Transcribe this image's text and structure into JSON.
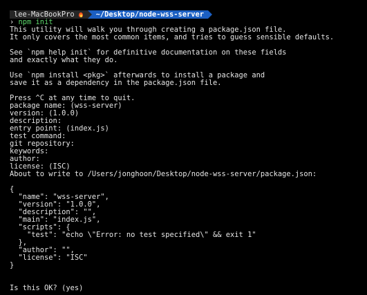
{
  "prompt": {
    "host": "lee-MacBookPro",
    "host_icon": "fire-icon",
    "path": "~/Desktop/node-wss-server"
  },
  "command": {
    "arrow": "›",
    "text": "npm init"
  },
  "output_lines": [
    "This utility will walk you through creating a package.json file.",
    "It only covers the most common items, and tries to guess sensible defaults.",
    "",
    "See `npm help init` for definitive documentation on these fields",
    "and exactly what they do.",
    "",
    "Use `npm install <pkg>` afterwards to install a package and",
    "save it as a dependency in the package.json file.",
    "",
    "Press ^C at any time to quit.",
    "package name: (wss-server)",
    "version: (1.0.0)",
    "description:",
    "entry point: (index.js)",
    "test command:",
    "git repository:",
    "keywords:",
    "author:",
    "license: (ISC)",
    "About to write to /Users/jonghoon/Desktop/node-wss-server/package.json:",
    "",
    "{",
    "  \"name\": \"wss-server\",",
    "  \"version\": \"1.0.0\",",
    "  \"description\": \"\",",
    "  \"main\": \"index.js\",",
    "  \"scripts\": {",
    "    \"test\": \"echo \\\"Error: no test specified\\\" && exit 1\"",
    "  },",
    "  \"author\": \"\",",
    "  \"license\": \"ISC\"",
    "}",
    "",
    "",
    "Is this OK? (yes)"
  ],
  "colors": {
    "background": "#000000",
    "text": "#e6e6e6",
    "host_segment": "#262626",
    "path_segment": "#1b5fc2",
    "command": "#5cd66a"
  }
}
